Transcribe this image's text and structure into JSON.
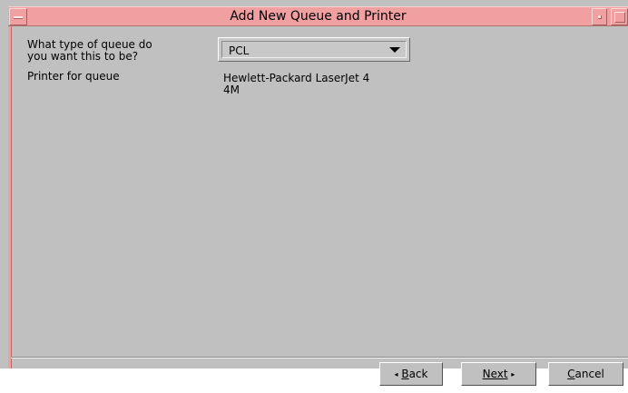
{
  "window": {
    "title": "Add New Queue and Printer"
  },
  "form": {
    "queue_type_label": "What type of queue do\nyou want this to be?",
    "queue_type_value": "PCL",
    "printer_label": "Printer for queue",
    "printer_value": "Hewlett-Packard LaserJet 4\n4M"
  },
  "buttons": {
    "back_arrow": "◂",
    "back_mnemonic": "B",
    "back_rest": "ack",
    "next_label": "Next",
    "next_arrow": "▸",
    "cancel_mnemonic": "C",
    "cancel_rest": "ancel"
  },
  "icons": {
    "window_menu": "window-menu-icon",
    "minimize": "minimize-icon",
    "maximize": "maximize-icon",
    "dropdown": "chevron-down-icon"
  },
  "colors": {
    "titlebar": "#f0a0a0",
    "window_bg": "#c0c0c0"
  }
}
